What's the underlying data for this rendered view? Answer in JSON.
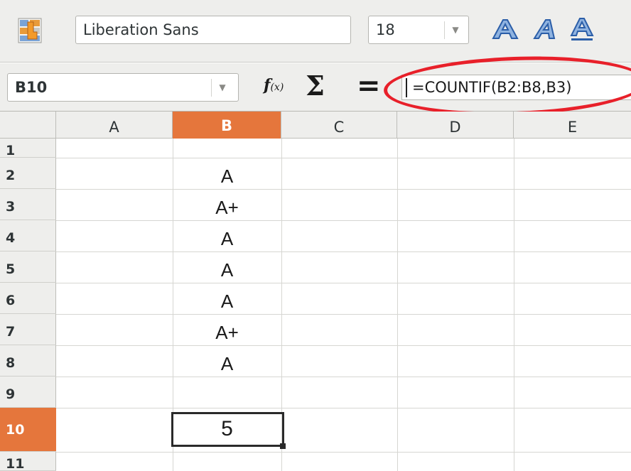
{
  "toolbar": {
    "font_name": "Liberation Sans",
    "font_size": "18",
    "icons": [
      "clone-formatting-icon",
      "chevron-down-icon",
      "outline-font-icon",
      "shadow-font-icon",
      "underline-font-icon"
    ]
  },
  "formula_bar": {
    "name_box": "B10",
    "fx_label": "f",
    "fx_sub": "(x)",
    "sum_label": "Σ",
    "equals_label": "=",
    "formula": "=COUNTIF(B2:B8,B3)"
  },
  "columns": [
    "A",
    "B",
    "C",
    "D",
    "E"
  ],
  "selected_column": "B",
  "rows": [
    "1",
    "2",
    "3",
    "4",
    "5",
    "6",
    "7",
    "8",
    "9",
    "10",
    "11"
  ],
  "selected_row": "10",
  "cells": {
    "B2": "A",
    "B3": "A+",
    "B4": "A",
    "B5": "A",
    "B6": "A",
    "B7": "A+",
    "B8": "A",
    "B10": "5"
  },
  "colors": {
    "selection_header": "#e5763c",
    "annotation": "#e8202a",
    "toolbar_bg": "#eeeeec"
  }
}
